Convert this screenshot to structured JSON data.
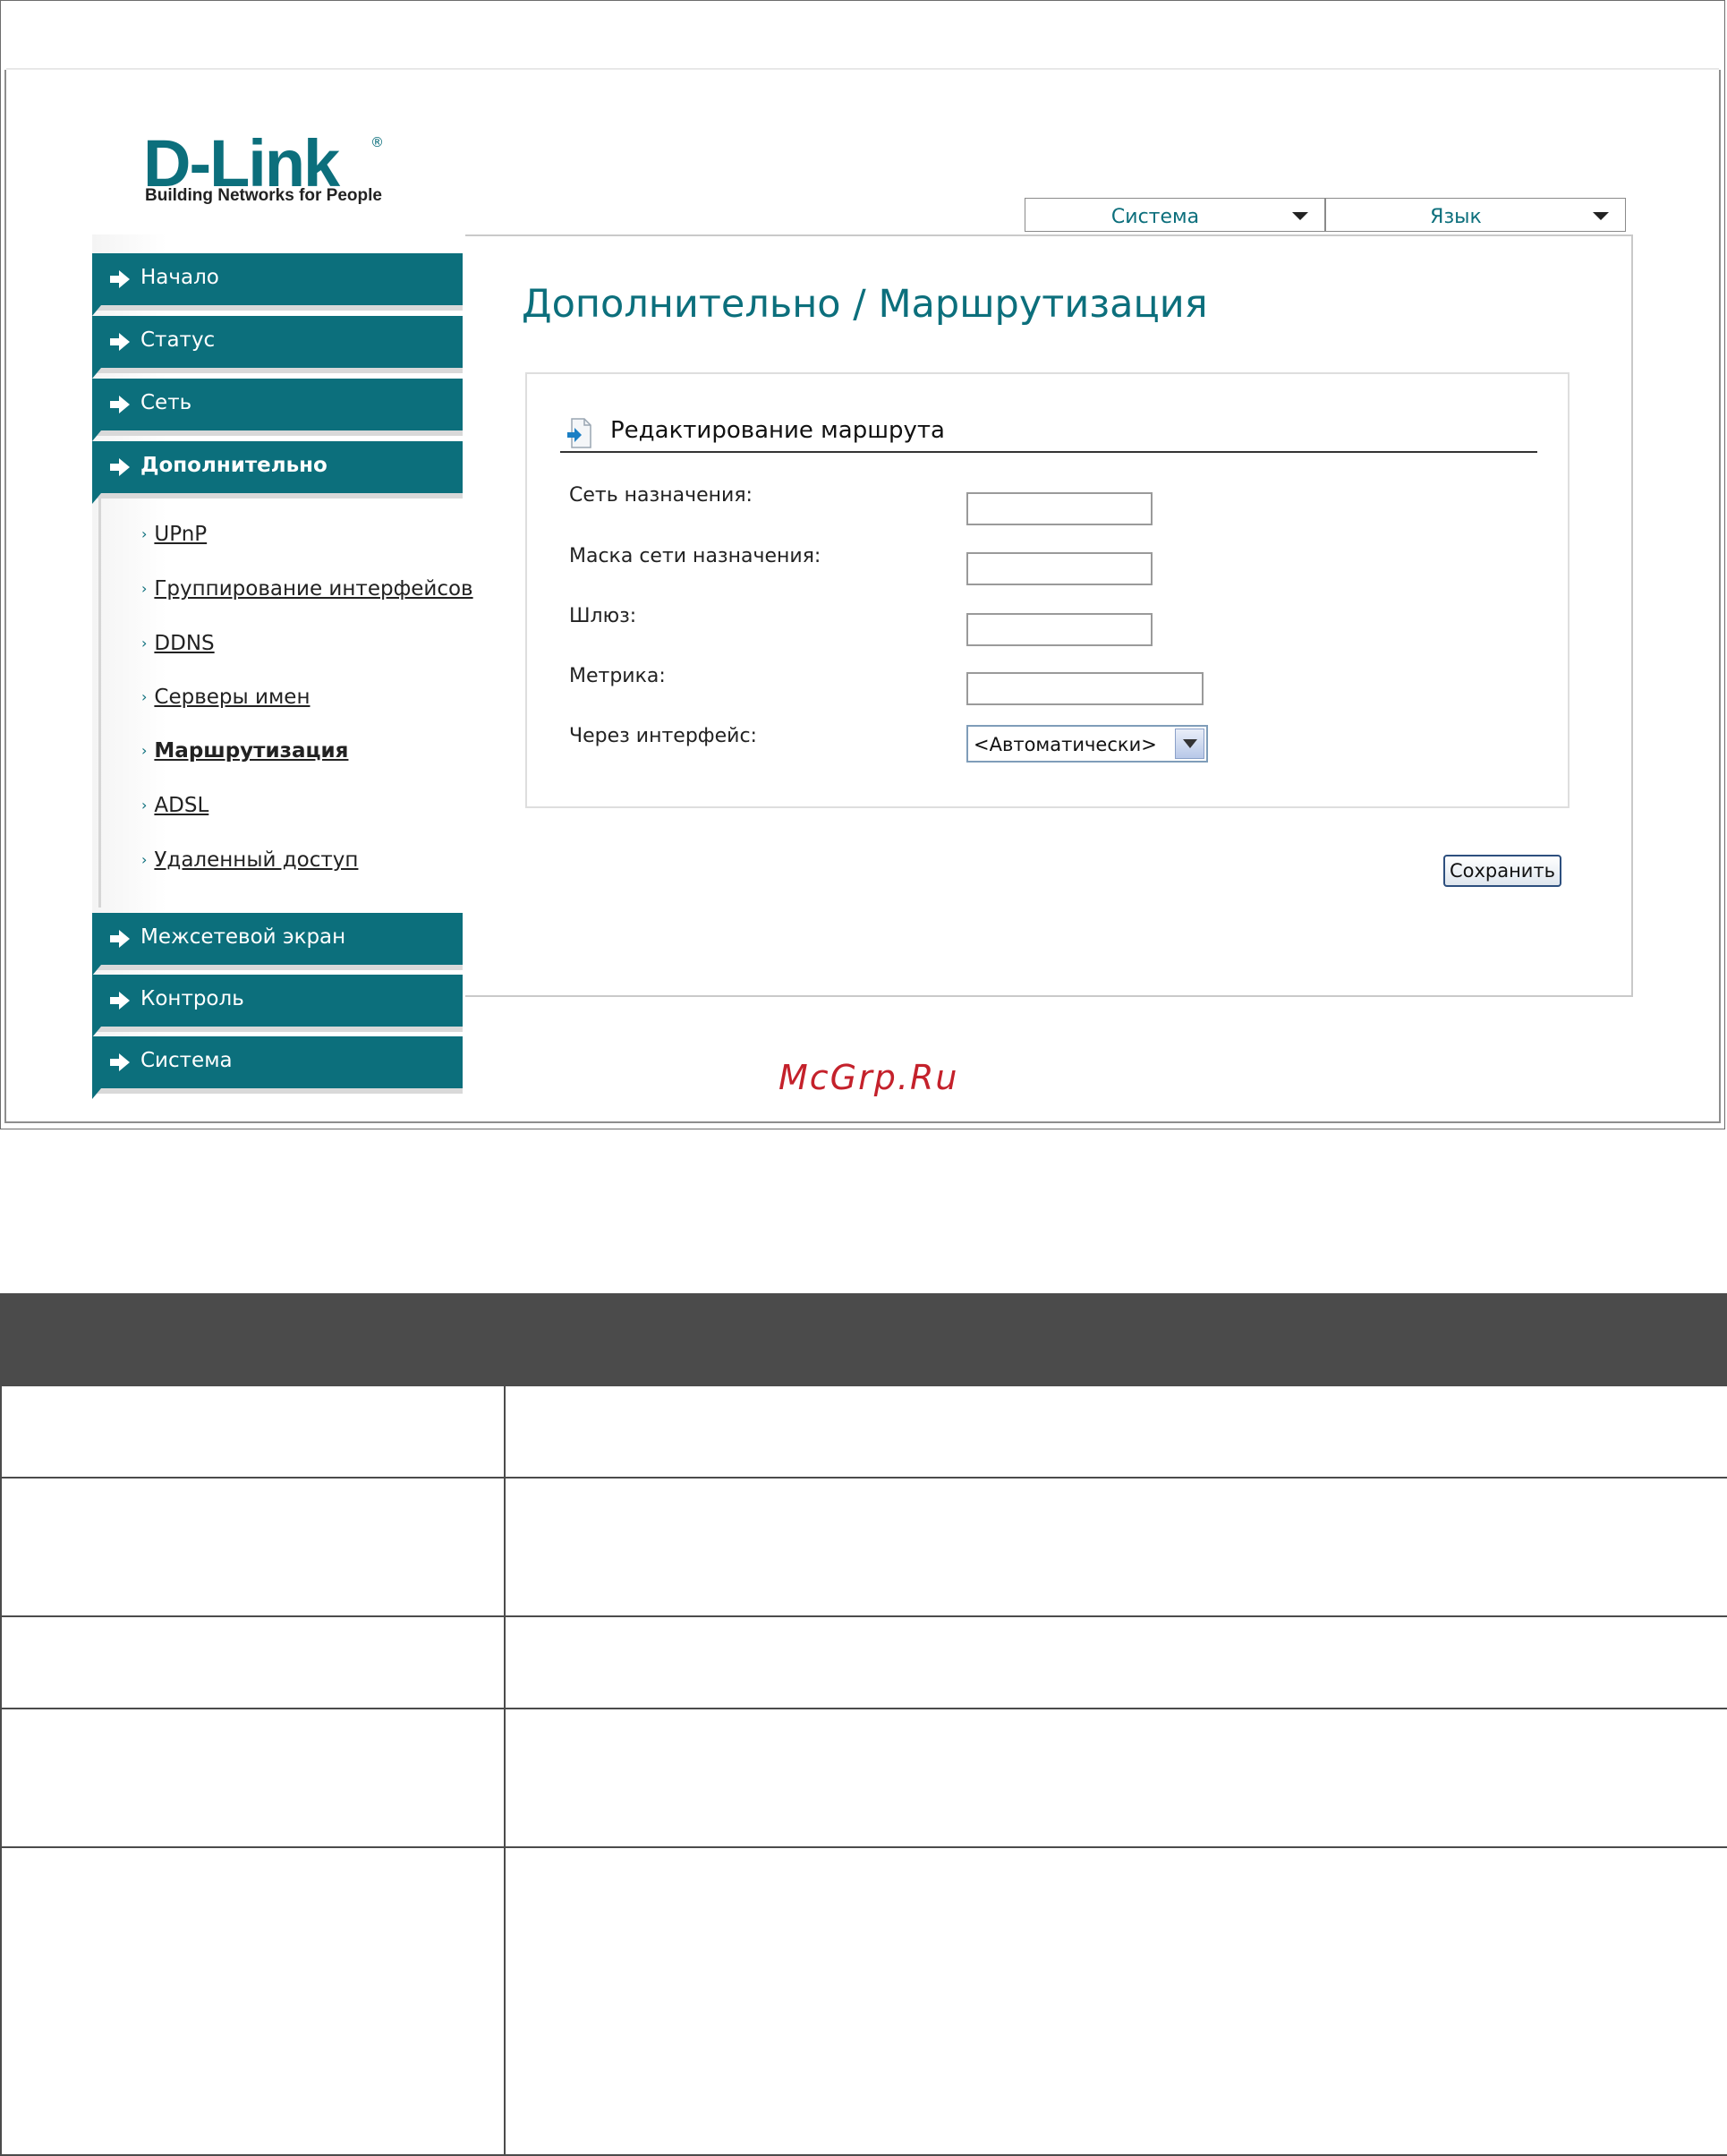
{
  "logo": {
    "brand": "D-Link",
    "registered": "®",
    "tagline": "Building Networks for People"
  },
  "top_menu": [
    {
      "label": "Система"
    },
    {
      "label": "Язык"
    }
  ],
  "sidebar": {
    "items": [
      {
        "label": "Начало"
      },
      {
        "label": "Статус"
      },
      {
        "label": "Сеть"
      },
      {
        "label": "Дополнительно"
      },
      {
        "label": "Межсетевой экран"
      },
      {
        "label": "Контроль"
      },
      {
        "label": "Система"
      }
    ],
    "subitems": [
      {
        "label": "UPnP"
      },
      {
        "label": "Группирование интерфейсов"
      },
      {
        "label": "DDNS"
      },
      {
        "label": "Серверы имен"
      },
      {
        "label": "Маршрутизация"
      },
      {
        "label": "ADSL"
      },
      {
        "label": "Удаленный доступ"
      }
    ]
  },
  "main": {
    "title": "Дополнительно /  Маршрутизация",
    "form": {
      "title": "Редактирование маршрута",
      "fields": {
        "destination": {
          "label": "Сеть назначения:",
          "value": ""
        },
        "mask": {
          "label": "Маска сети назначения:",
          "value": ""
        },
        "gateway": {
          "label": "Шлюз:",
          "value": ""
        },
        "metric": {
          "label": "Метрика:",
          "value": ""
        },
        "interface": {
          "label": "Через интерфейс:",
          "value": "<Автоматически>"
        }
      }
    },
    "save_label": "Сохранить"
  },
  "watermark": "McGrp.Ru",
  "colors": {
    "accent": "#0c6f7c",
    "table_header": "#4b4b4b",
    "watermark": "#c4212b"
  }
}
